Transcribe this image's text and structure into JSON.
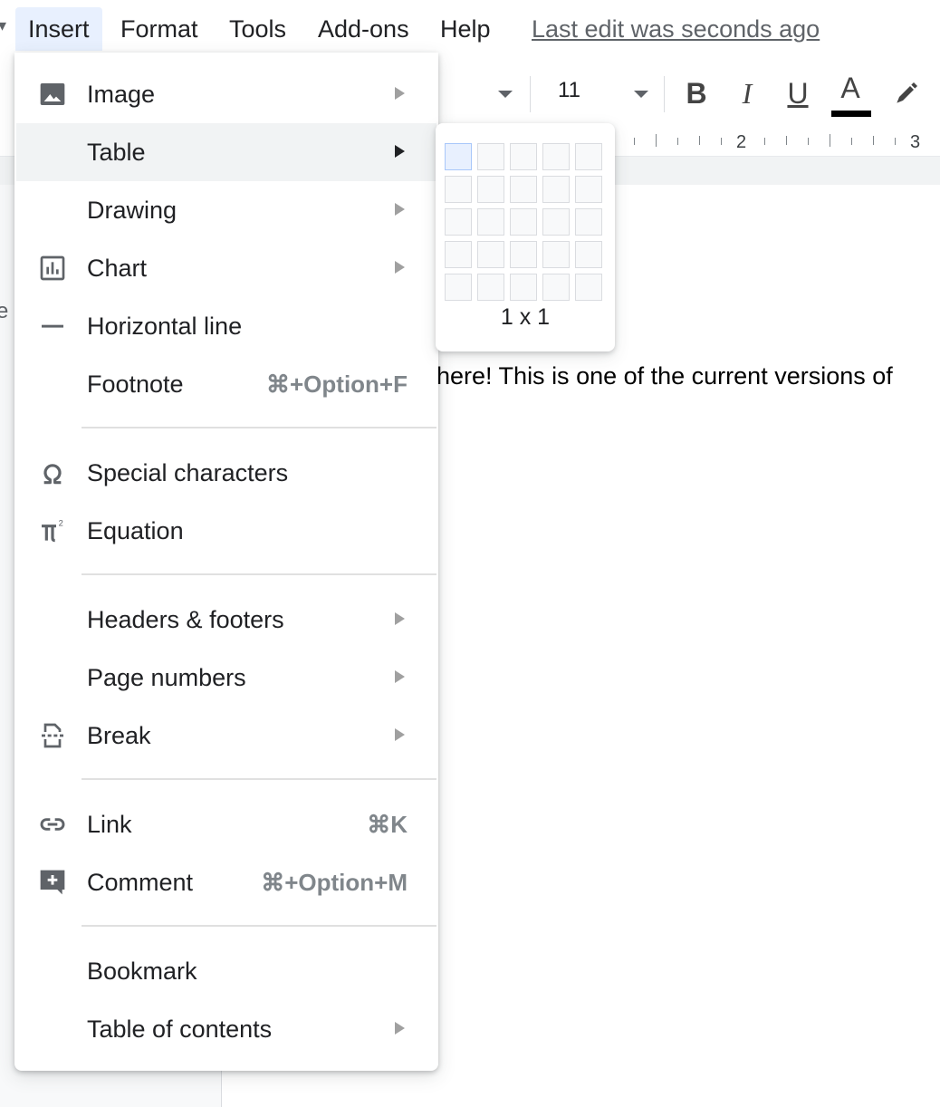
{
  "menubar": {
    "items": [
      "Insert",
      "Format",
      "Tools",
      "Add-ons",
      "Help"
    ],
    "status": "Last edit was seconds ago"
  },
  "toolbar": {
    "font_size": "11",
    "bold": "B",
    "italic": "I",
    "underline": "U",
    "text_color": "A"
  },
  "ruler": {
    "marks": [
      "2",
      "3"
    ]
  },
  "document": {
    "text": "here! This is one of the current versions of",
    "left_fragment": "e c"
  },
  "insert_menu": {
    "items": [
      {
        "label": "Image",
        "icon": "image-icon",
        "submenu": true
      },
      {
        "label": "Table",
        "icon": "",
        "submenu": true
      },
      {
        "label": "Drawing",
        "icon": "",
        "submenu": true
      },
      {
        "label": "Chart",
        "icon": "chart-icon",
        "submenu": true
      },
      {
        "label": "Horizontal line",
        "icon": "horizontal-line-icon"
      },
      {
        "label": "Footnote",
        "shortcut": "⌘+Option+F"
      },
      {
        "label": "Special characters",
        "icon": "omega-icon"
      },
      {
        "label": "Equation",
        "icon": "pi-squared-icon"
      },
      {
        "label": "Headers & footers",
        "submenu": true
      },
      {
        "label": "Page numbers",
        "submenu": true
      },
      {
        "label": "Break",
        "icon": "page-break-icon",
        "submenu": true
      },
      {
        "label": "Link",
        "icon": "link-icon",
        "shortcut": "⌘K"
      },
      {
        "label": "Comment",
        "icon": "comment-add-icon",
        "shortcut": "⌘+Option+M"
      },
      {
        "label": "Bookmark"
      },
      {
        "label": "Table of contents",
        "submenu": true
      }
    ]
  },
  "table_picker": {
    "rows": 5,
    "cols": 5,
    "selected": "1 x 1"
  }
}
